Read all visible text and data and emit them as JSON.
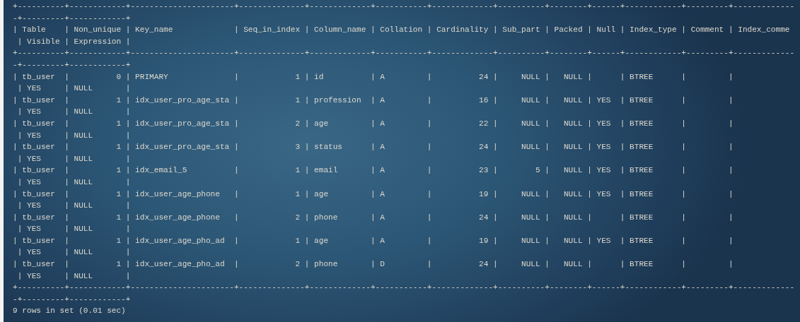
{
  "terminal": {
    "lines": [
      "+----------+------------+----------------------+--------------+-------------+-----------+-------------+----------+--------+------+------------+---------+-------------",
      "-+---------+------------+",
      "| Table    | Non_unique | Key_name             | Seq_in_index | Column_name | Collation | Cardinality | Sub_part | Packed | Null | Index_type | Comment | Index_comme",
      " | Visible | Expression |",
      "+----------+------------+----------------------+--------------+-------------+-----------+-------------+----------+--------+------+------------+---------+-------------",
      "-+---------+------------+",
      "| tb_user  |          0 | PRIMARY              |            1 | id          | A         |          24 |     NULL |   NULL |      | BTREE      |         |",
      " | YES     | NULL       |",
      "| tb_user  |          1 | idx_user_pro_age_sta |            1 | profession  | A         |          16 |     NULL |   NULL | YES  | BTREE      |         |",
      " | YES     | NULL       |",
      "| tb_user  |          1 | idx_user_pro_age_sta |            2 | age         | A         |          22 |     NULL |   NULL | YES  | BTREE      |         |",
      " | YES     | NULL       |",
      "| tb_user  |          1 | idx_user_pro_age_sta |            3 | status      | A         |          24 |     NULL |   NULL | YES  | BTREE      |         |",
      " | YES     | NULL       |",
      "| tb_user  |          1 | idx_email_5          |            1 | email       | A         |          23 |        5 |   NULL | YES  | BTREE      |         |",
      " | YES     | NULL       |",
      "| tb_user  |          1 | idx_user_age_phone   |            1 | age         | A         |          19 |     NULL |   NULL | YES  | BTREE      |         |",
      " | YES     | NULL       |",
      "| tb_user  |          1 | idx_user_age_phone   |            2 | phone       | A         |          24 |     NULL |   NULL |      | BTREE      |         |",
      " | YES     | NULL       |",
      "| tb_user  |          1 | idx_user_age_pho_ad  |            1 | age         | A         |          19 |     NULL |   NULL | YES  | BTREE      |         |",
      " | YES     | NULL       |",
      "| tb_user  |          1 | idx_user_age_pho_ad  |            2 | phone       | D         |          24 |     NULL |   NULL |      | BTREE      |         |",
      " | YES     | NULL       |",
      "+----------+------------+----------------------+--------------+-------------+-----------+-------------+----------+--------+------+------------+---------+-------------",
      "-+---------+------------+",
      "9 rows in set (0.01 sec)"
    ]
  }
}
